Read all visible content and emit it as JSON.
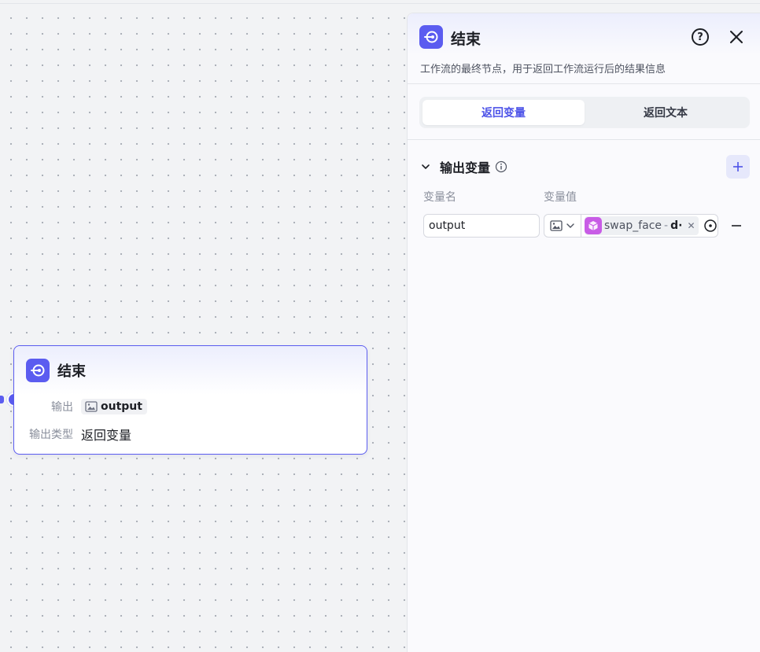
{
  "colors": {
    "accent": "#5b5cf0",
    "tab_active": "#4d53e8",
    "plugin": "#c85ce6"
  },
  "node": {
    "title": "结束",
    "icon": "end-node-icon",
    "output_label": "输出",
    "output_value": "output",
    "output_type_label": "输出类型",
    "output_type_value": "返回变量"
  },
  "panel": {
    "title": "结束",
    "description": "工作流的最终节点，用于返回工作流运行后的结果信息",
    "help_icon": "question-circle-icon",
    "close_icon": "close-icon",
    "tabs": [
      {
        "label": "返回变量",
        "active": true
      },
      {
        "label": "返回文本",
        "active": false
      }
    ],
    "section": {
      "title": "输出变量",
      "col_name": "变量名",
      "col_value": "变量值",
      "add_icon": "plus-icon",
      "rows": [
        {
          "name": "output",
          "type_icon": "image-icon",
          "ref_node": "swap_face",
          "ref_sep": "-",
          "ref_field": "d·",
          "remove_icon": "minus-icon"
        }
      ]
    }
  }
}
